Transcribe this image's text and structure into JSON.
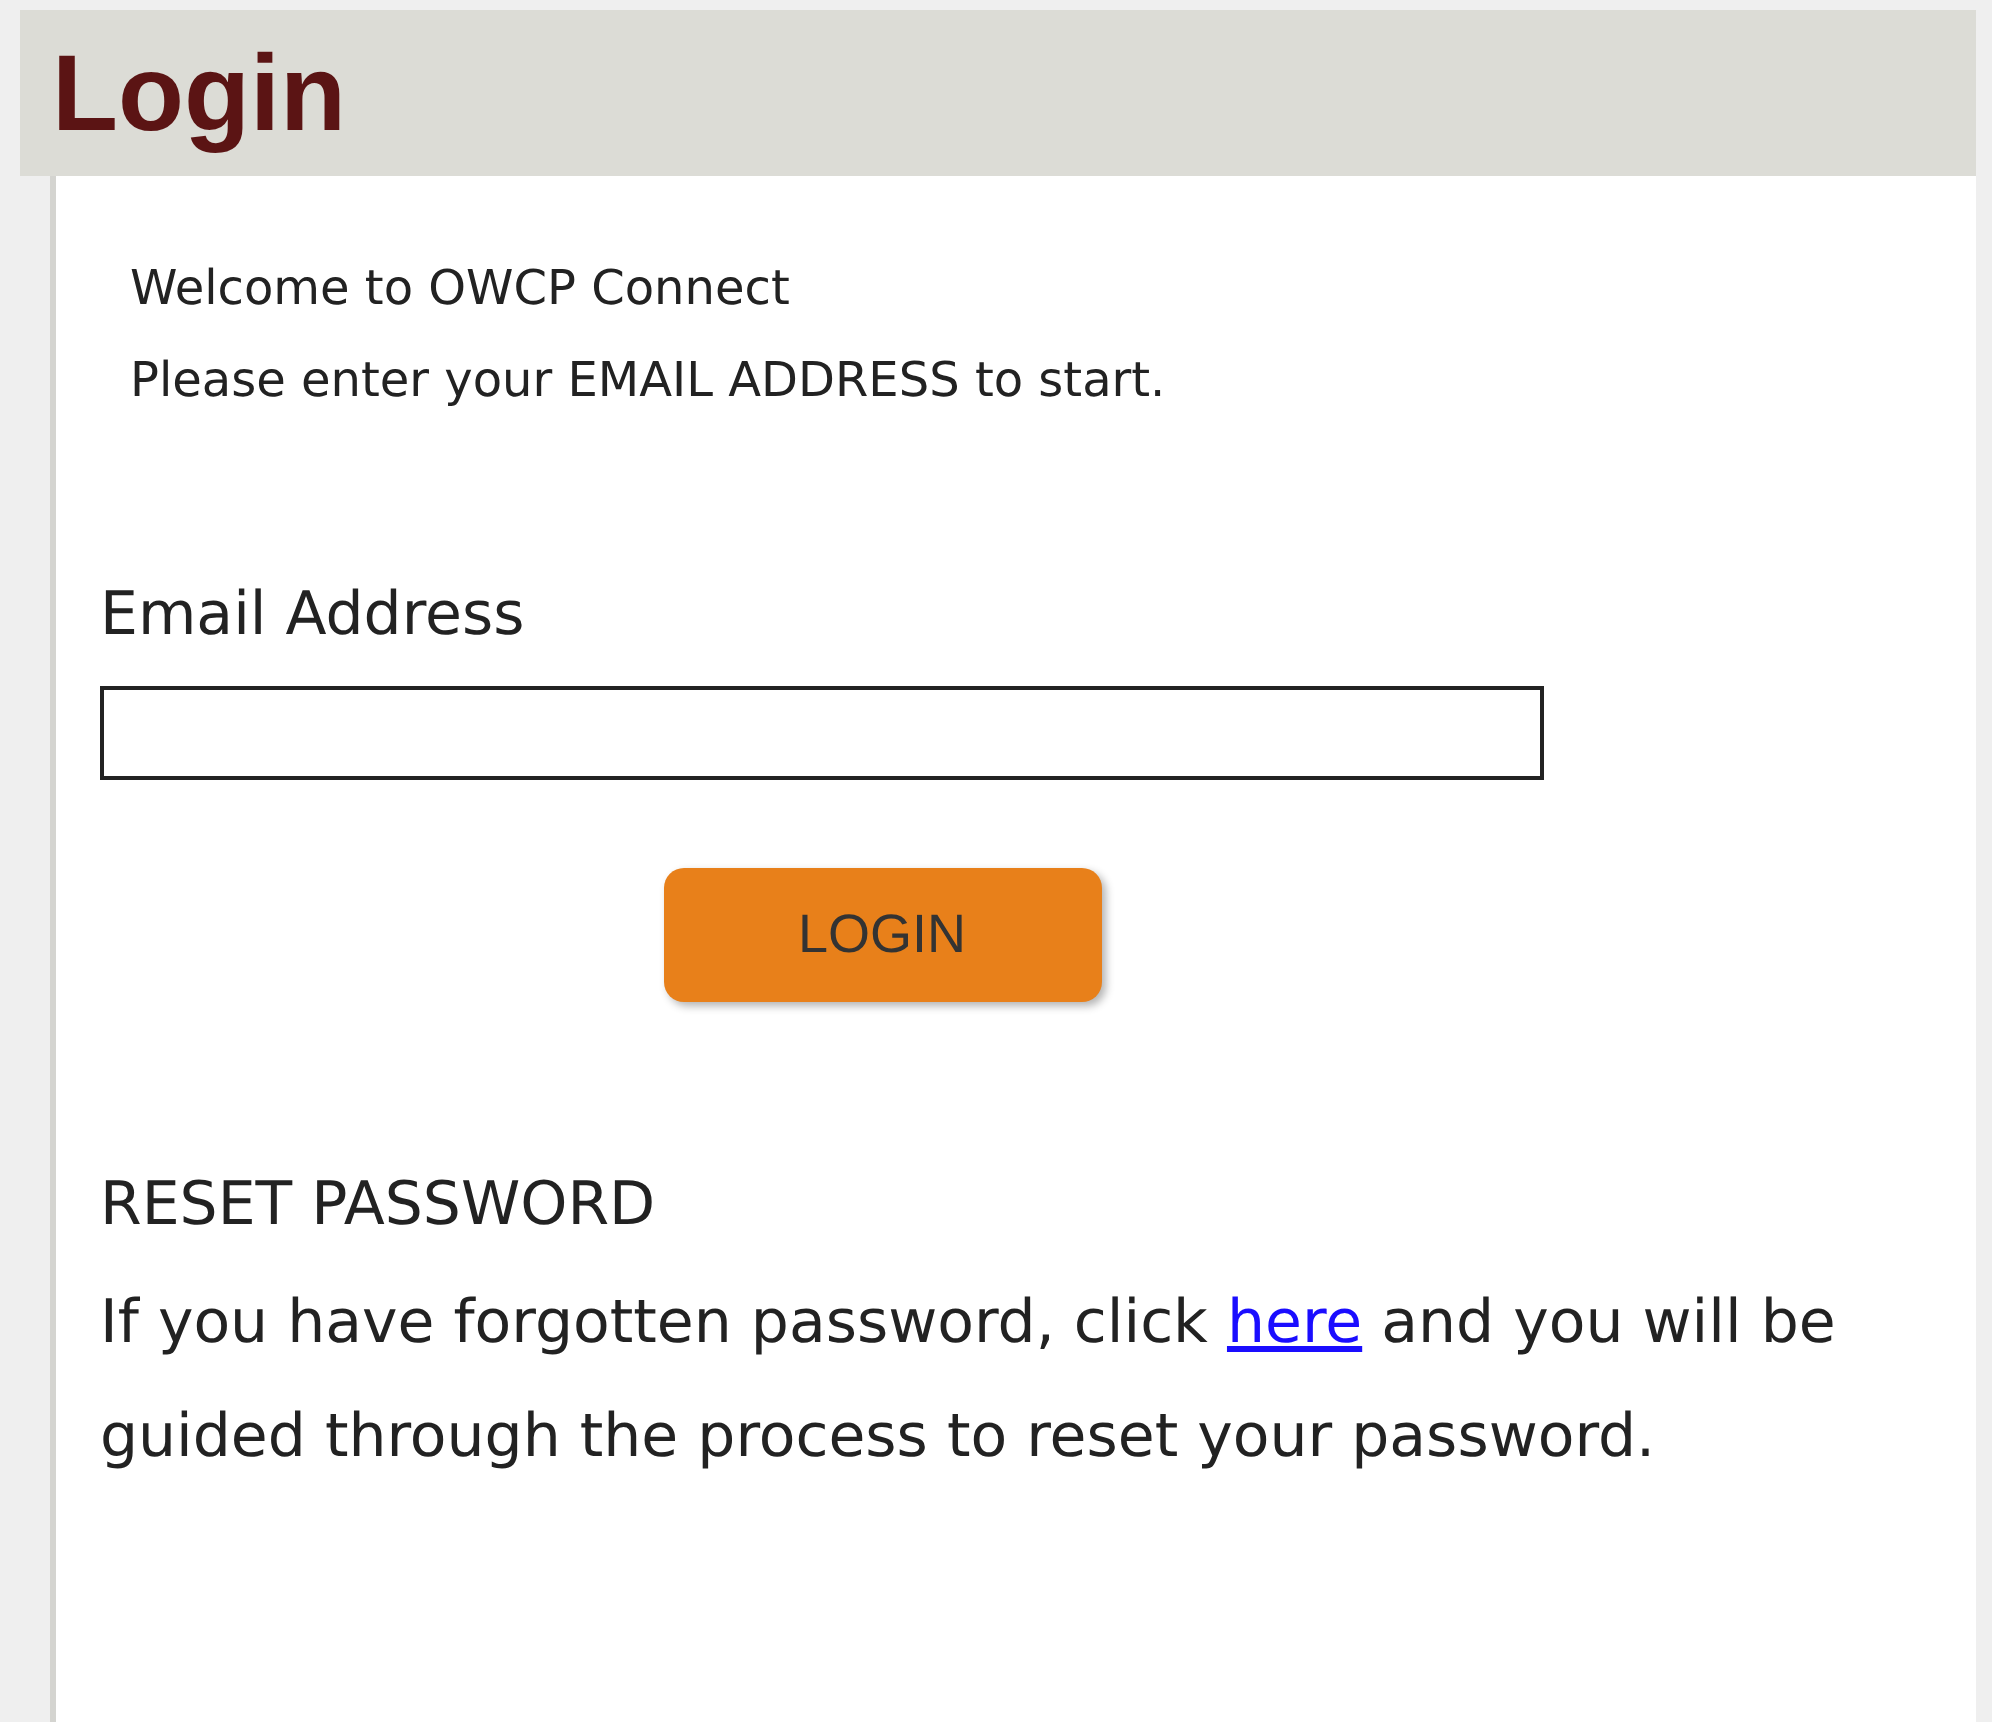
{
  "header": {
    "title": "Login"
  },
  "intro": [
    "Welcome to OWCP Connect",
    "Please enter your EMAIL ADDRESS to start."
  ],
  "email": {
    "label": "Email Address"
  },
  "login_button": "LOGIN",
  "reset": {
    "heading": "RESET PASSWORD",
    "text_before": "If you have forgotten password, click",
    "link": "here",
    "text_after": "and you will be guided through the process to reset your password."
  }
}
